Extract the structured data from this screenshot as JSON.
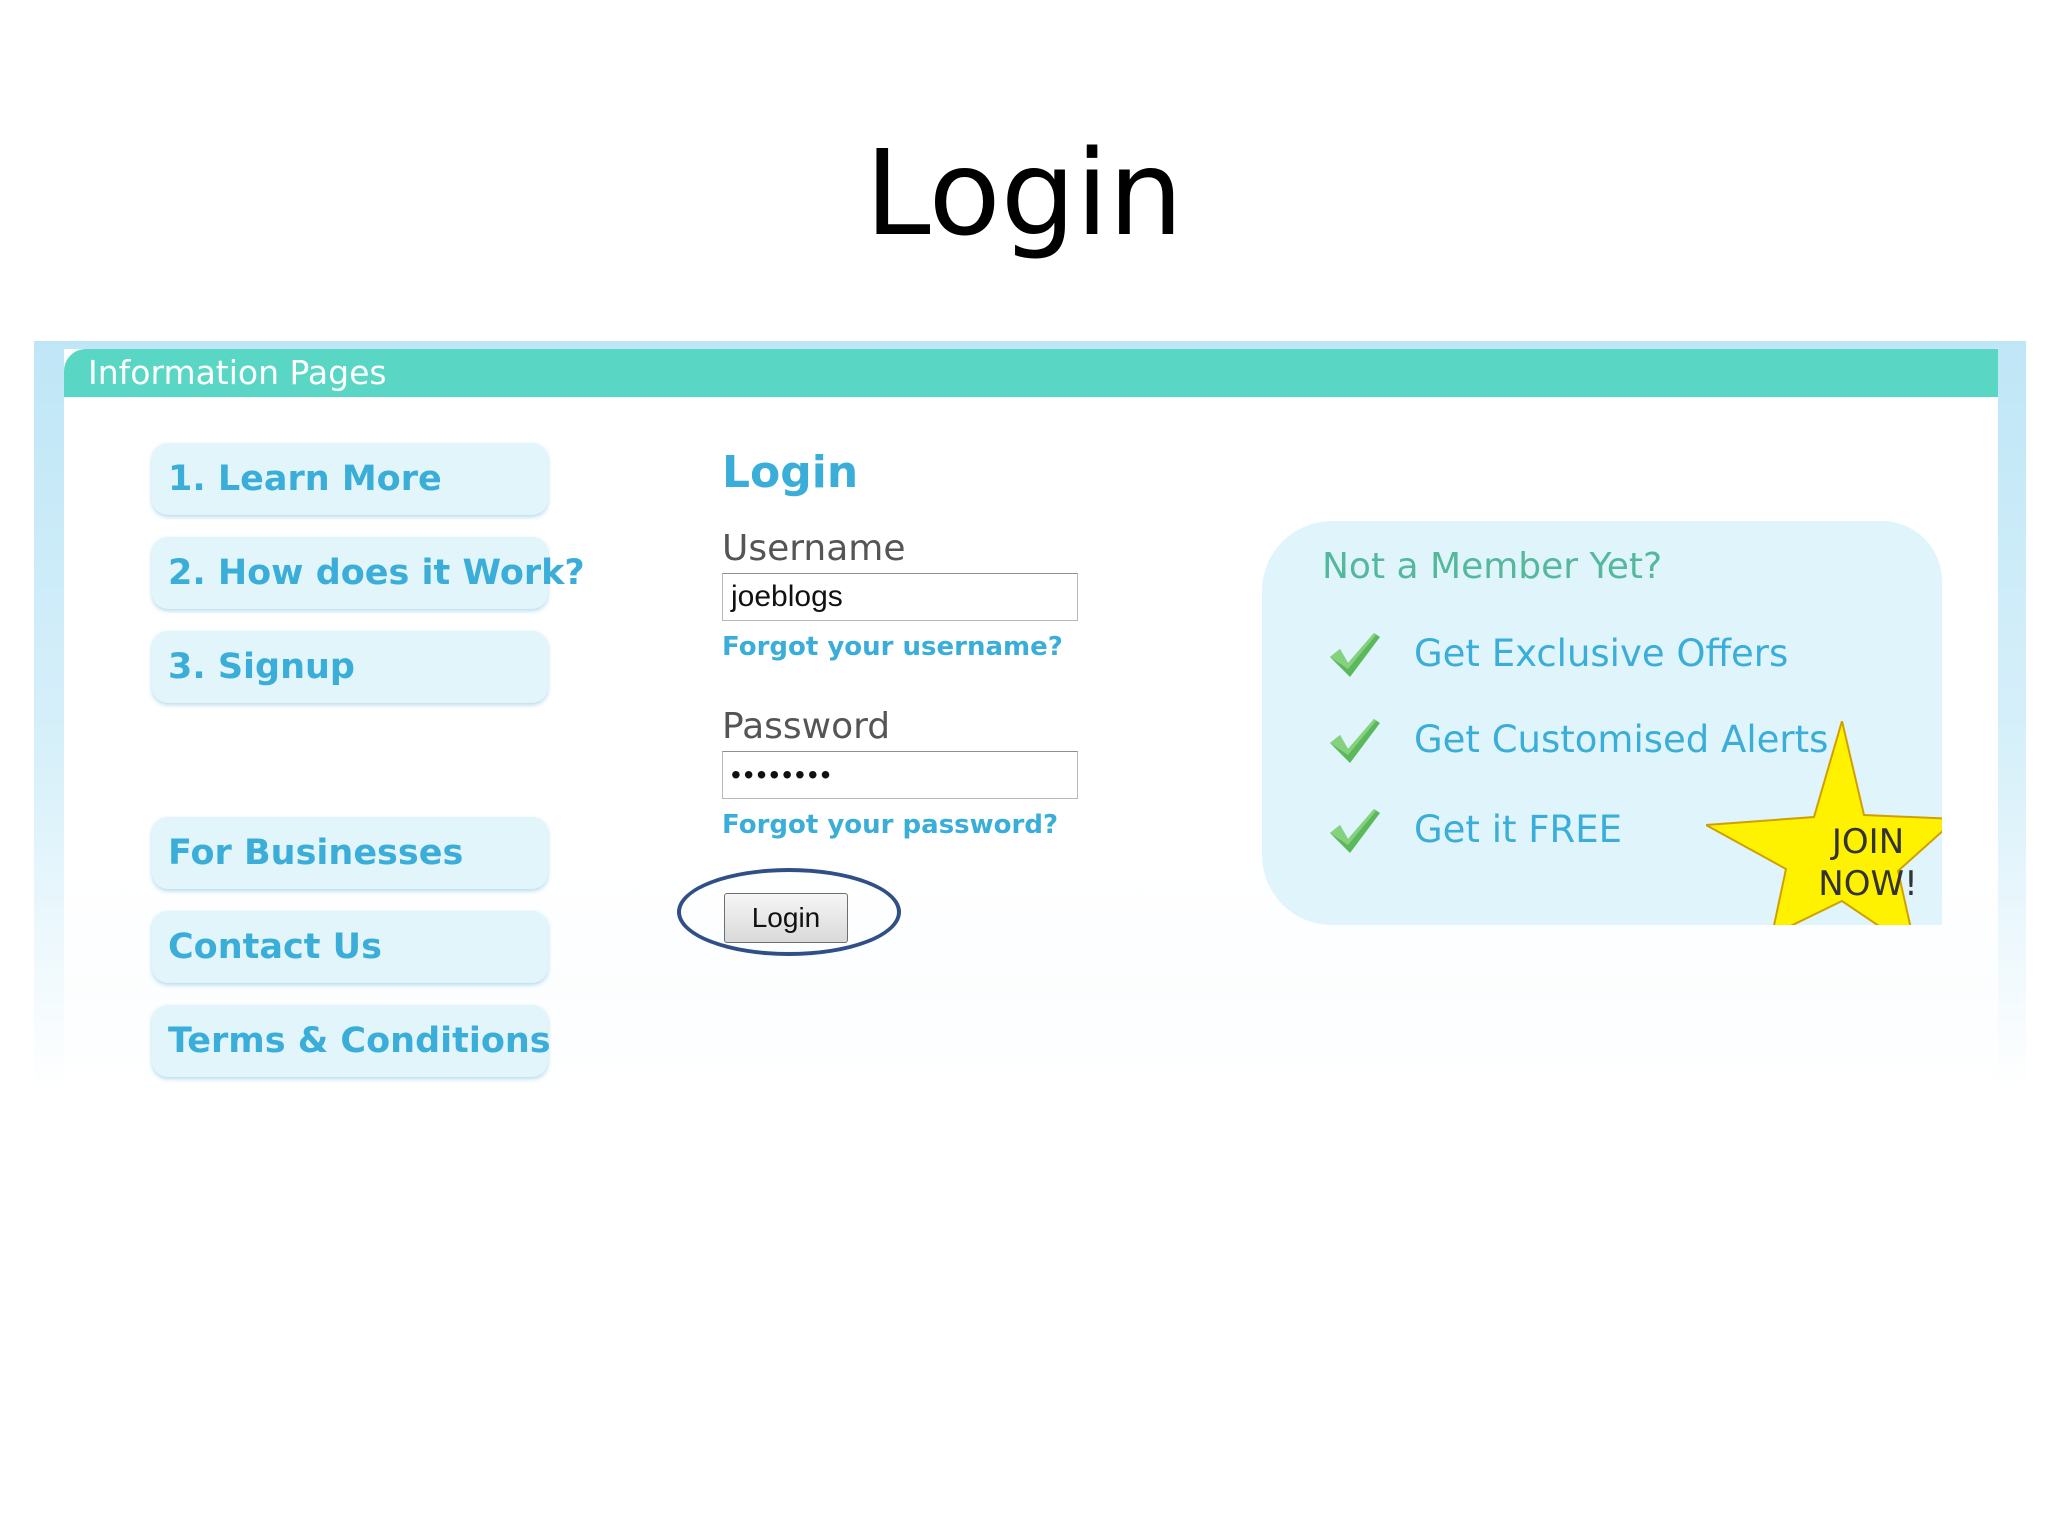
{
  "slide": {
    "title": "Login"
  },
  "info_bar": {
    "title": "Information Pages"
  },
  "sidebar": {
    "items": [
      {
        "label": "1. Learn More"
      },
      {
        "label": "2. How does it Work?"
      },
      {
        "label": "3. Signup"
      },
      {
        "label": "For Businesses"
      },
      {
        "label": "Contact Us"
      },
      {
        "label": "Terms & Conditions"
      }
    ]
  },
  "login_form": {
    "heading": "Login",
    "username_label": "Username",
    "username_value": "joeblogs",
    "forgot_username": "Forgot your username?",
    "password_label": "Password",
    "password_value": "••••••••",
    "forgot_password": "Forgot your password?",
    "submit_label": "Login"
  },
  "promo": {
    "heading": "Not a Member Yet?",
    "benefits": [
      {
        "label": "Get Exclusive Offers",
        "icon": "checkmark-icon"
      },
      {
        "label": "Get Customised Alerts",
        "icon": "checkmark-icon"
      },
      {
        "label": "Get it FREE",
        "icon": "checkmark-icon"
      }
    ],
    "join_line1": "JOIN",
    "join_line2": "NOW!"
  },
  "colors": {
    "accent": "#3aaed8",
    "info_bar": "#5ad7c4",
    "check_green": "#5cb85c",
    "star_yellow": "#fff200",
    "annotation_circle": "#2f4f86"
  }
}
